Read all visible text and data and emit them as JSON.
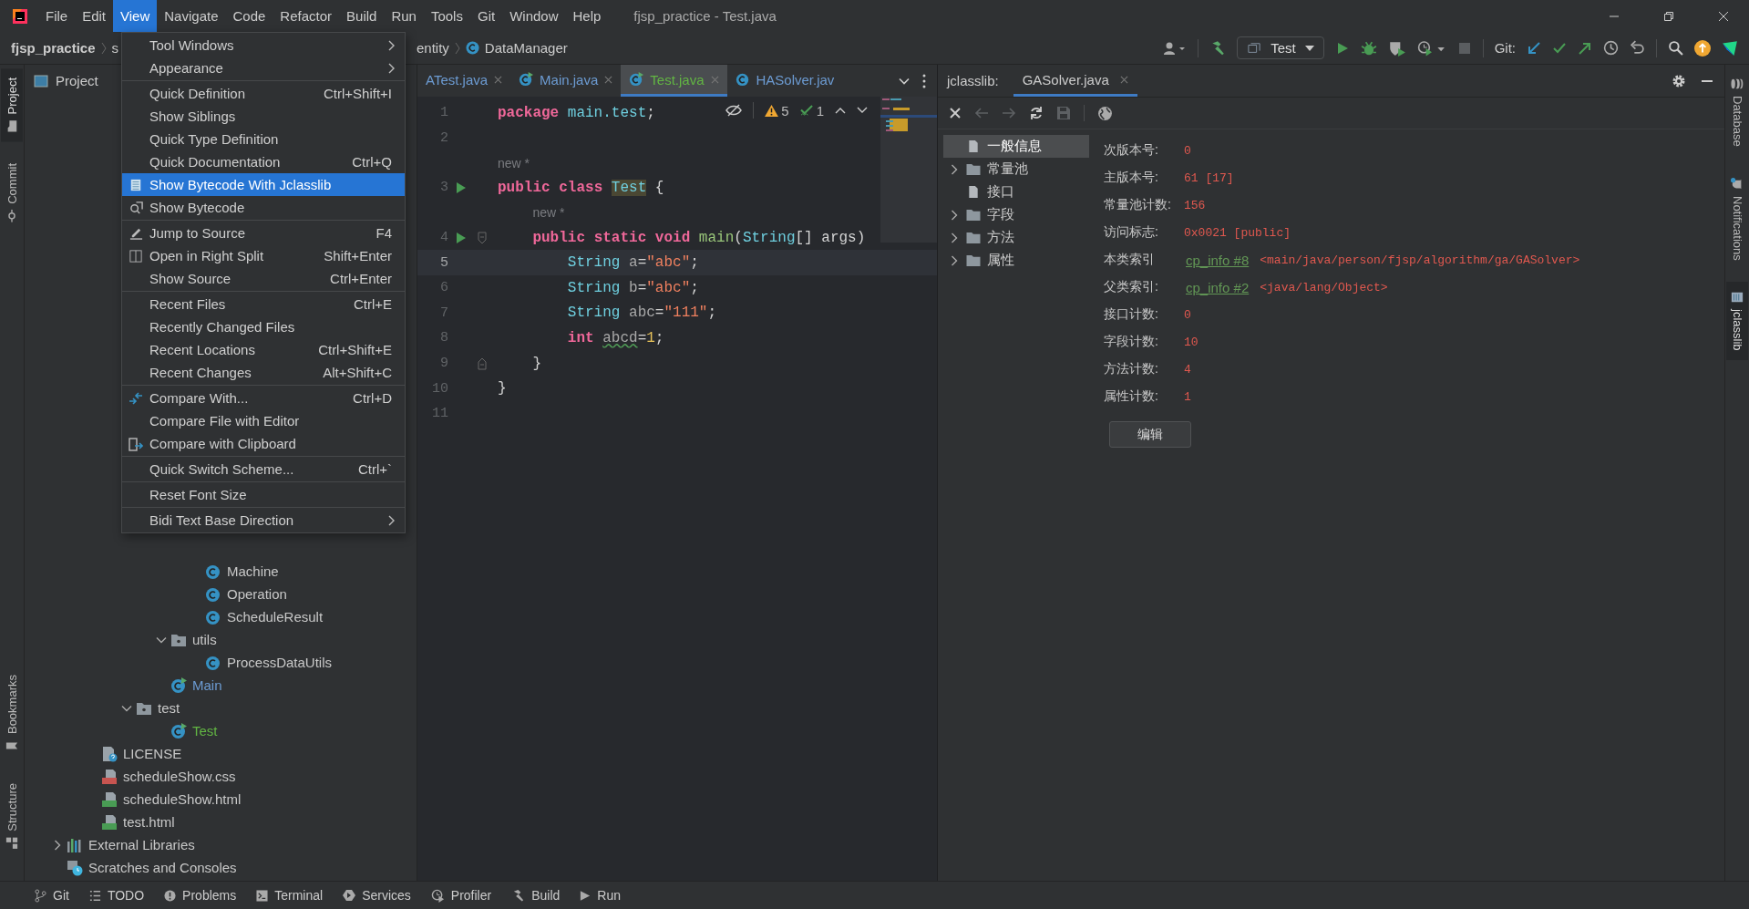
{
  "title_bar": {
    "menu": [
      {
        "label": "File",
        "selected": false
      },
      {
        "label": "Edit",
        "selected": false
      },
      {
        "label": "View",
        "selected": true
      },
      {
        "label": "Navigate",
        "selected": false
      },
      {
        "label": "Code",
        "selected": false
      },
      {
        "label": "Refactor",
        "selected": false
      },
      {
        "label": "Build",
        "selected": false
      },
      {
        "label": "Run",
        "selected": false
      },
      {
        "label": "Tools",
        "selected": false
      },
      {
        "label": "Git",
        "selected": false
      },
      {
        "label": "Window",
        "selected": false
      },
      {
        "label": "Help",
        "selected": false
      }
    ],
    "title": "fjsp_practice - Test.java"
  },
  "breadcrumb": {
    "left": [
      "fjsp_practice",
      "s"
    ],
    "right": [
      "entity",
      "DataManager"
    ]
  },
  "toolbar": {
    "run_config": "Test",
    "git_label": "Git:"
  },
  "left_strip": {
    "top": [
      {
        "label": "Project",
        "selected": true
      },
      {
        "label": "Commit",
        "selected": false
      }
    ],
    "bottom": [
      {
        "label": "Bookmarks",
        "selected": false
      },
      {
        "label": "Structure",
        "selected": false
      }
    ]
  },
  "project": {
    "title": "Project",
    "tree": [
      {
        "children": [
          {
            "children": [
              {
                "children": [
                  {
                    "children": [
                      {
                        "label": "Machine",
                        "kind": "class"
                      },
                      {
                        "label": "Operation",
                        "kind": "class"
                      },
                      {
                        "label": "ScheduleResult",
                        "kind": "class"
                      }
                    ]
                  },
                  {
                    "label": "utils",
                    "kind": "package",
                    "expanded": true,
                    "children": [
                      {
                        "label": "ProcessDataUtils",
                        "kind": "class"
                      }
                    ]
                  },
                  {
                    "label": "Main",
                    "kind": "runnable-class",
                    "color": "#6c9bd2"
                  }
                ]
              },
              {
                "label": "test",
                "kind": "package",
                "expanded": true,
                "children": [
                  {
                    "label": "Test",
                    "kind": "runnable-class",
                    "color": "#62b543"
                  }
                ]
              }
            ]
          },
          {
            "label": "LICENSE",
            "kind": "license"
          },
          {
            "label": "scheduleShow.css",
            "kind": "css"
          },
          {
            "label": "scheduleShow.html",
            "kind": "html"
          },
          {
            "label": "test.html",
            "kind": "html"
          }
        ]
      },
      {
        "label": "External Libraries",
        "kind": "libraries",
        "expanded": false
      },
      {
        "label": "Scratches and Consoles",
        "kind": "scratches"
      }
    ]
  },
  "menu": {
    "groups": [
      [
        {
          "label": "Tool Windows",
          "kind": "submenu",
          "selected": false
        },
        {
          "label": "Appearance",
          "kind": "submenu",
          "selected": false
        }
      ],
      [
        {
          "label": "Quick Definition",
          "shortcut": "Ctrl+Shift+I",
          "kind": "action",
          "selected": false
        },
        {
          "label": "Show Siblings",
          "kind": "action",
          "selected": false
        },
        {
          "label": "Quick Type Definition",
          "kind": "action",
          "selected": false
        },
        {
          "label": "Quick Documentation",
          "shortcut": "Ctrl+Q",
          "kind": "action",
          "selected": false
        },
        {
          "label": "Show Bytecode With Jclasslib",
          "kind": "action",
          "selected": true
        },
        {
          "label": "Show Bytecode",
          "kind": "action",
          "selected": false
        }
      ],
      [
        {
          "label": "Jump to Source",
          "shortcut": "F4",
          "kind": "action",
          "selected": false
        },
        {
          "label": "Open in Right Split",
          "shortcut": "Shift+Enter",
          "kind": "action",
          "selected": false
        },
        {
          "label": "Show Source",
          "shortcut": "Ctrl+Enter",
          "kind": "action",
          "selected": false
        }
      ],
      [
        {
          "label": "Recent Files",
          "shortcut": "Ctrl+E",
          "kind": "action",
          "selected": false
        },
        {
          "label": "Recently Changed Files",
          "kind": "action",
          "selected": false
        },
        {
          "label": "Recent Locations",
          "shortcut": "Ctrl+Shift+E",
          "kind": "action",
          "selected": false
        },
        {
          "label": "Recent Changes",
          "shortcut": "Alt+Shift+C",
          "kind": "action",
          "selected": false
        }
      ],
      [
        {
          "label": "Compare With...",
          "shortcut": "Ctrl+D",
          "kind": "action",
          "selected": false
        },
        {
          "label": "Compare File with Editor",
          "kind": "action",
          "selected": false
        },
        {
          "label": "Compare with Clipboard",
          "kind": "action",
          "selected": false
        }
      ],
      [
        {
          "label": "Quick Switch Scheme...",
          "shortcut": "Ctrl+`",
          "kind": "action",
          "selected": false
        }
      ],
      [
        {
          "label": "Reset Font Size",
          "kind": "action",
          "selected": false
        }
      ],
      [
        {
          "label": "Bidi Text Base Direction",
          "kind": "submenu",
          "selected": false
        }
      ]
    ]
  },
  "editor": {
    "tabs": [
      {
        "label": "ATest.java",
        "kind": "none",
        "color": "#6c9bd2",
        "selected": false,
        "closable": true
      },
      {
        "label": "Main.java",
        "kind": "runnable-class",
        "color": "#6c9bd2",
        "selected": false,
        "closable": true
      },
      {
        "label": "Test.java",
        "kind": "runnable-class",
        "color": "#62b543",
        "selected": true,
        "closable": true
      },
      {
        "label": "HASolver.jav",
        "kind": "class",
        "color": "#6c9bd2",
        "selected": false
      }
    ],
    "inspections": {
      "warnings": "5",
      "weak_warnings": "1"
    },
    "lines": [
      {
        "number": "1",
        "current": false,
        "run": false,
        "tokens": [
          {
            "text": "package ",
            "kind": "keyword"
          },
          {
            "text": "main.test",
            "kind": "type"
          },
          {
            "text": ";",
            "kind": "plain"
          }
        ]
      },
      {
        "number": "2",
        "current": false,
        "run": false
      },
      {
        "number": "3",
        "current": false,
        "run": true,
        "hint": "new *",
        "tokens": [
          {
            "text": "public ",
            "kind": "keyword"
          },
          {
            "text": "class ",
            "kind": "keyword"
          },
          {
            "text": "Test",
            "kind": "decl"
          },
          {
            "text": " {",
            "kind": "plain"
          }
        ]
      },
      {
        "number": "4",
        "current": false,
        "run": true,
        "fold_start": true,
        "hint": "new *",
        "tokens": [
          {
            "text": "    public ",
            "kind": "keyword"
          },
          {
            "text": "static ",
            "kind": "keyword"
          },
          {
            "text": "void ",
            "kind": "keyword"
          },
          {
            "text": "main",
            "kind": "method"
          },
          {
            "text": "(",
            "kind": "plain"
          },
          {
            "text": "String",
            "kind": "type"
          },
          {
            "text": "[] args)",
            "kind": "plain"
          }
        ]
      },
      {
        "number": "5",
        "current": true,
        "run": false,
        "tokens": [
          {
            "text": "        String ",
            "kind": "type"
          },
          {
            "text": "a",
            "kind": "variable"
          },
          {
            "text": "=",
            "kind": "plain"
          },
          {
            "text": "\"abc\"",
            "kind": "string"
          },
          {
            "text": ";",
            "kind": "plain"
          }
        ]
      },
      {
        "number": "6",
        "current": false,
        "run": false,
        "tokens": [
          {
            "text": "        String ",
            "kind": "type"
          },
          {
            "text": "b",
            "kind": "variable"
          },
          {
            "text": "=",
            "kind": "plain"
          },
          {
            "text": "\"abc\"",
            "kind": "string"
          },
          {
            "text": ";",
            "kind": "plain"
          }
        ]
      },
      {
        "number": "7",
        "current": false,
        "run": false,
        "tokens": [
          {
            "text": "        String ",
            "kind": "type"
          },
          {
            "text": "abc",
            "kind": "variable"
          },
          {
            "text": "=",
            "kind": "plain"
          },
          {
            "text": "\"111\"",
            "kind": "string"
          },
          {
            "text": ";",
            "kind": "plain"
          }
        ]
      },
      {
        "number": "8",
        "current": false,
        "run": false,
        "tokens": [
          {
            "text": "        int ",
            "kind": "keyword"
          },
          {
            "text": "abcd",
            "kind": "unused"
          },
          {
            "text": "=",
            "kind": "plain"
          },
          {
            "text": "1",
            "kind": "number"
          },
          {
            "text": ";",
            "kind": "plain"
          }
        ]
      },
      {
        "number": "9",
        "current": false,
        "run": false,
        "fold_end": true,
        "tokens": [
          {
            "text": "    }",
            "kind": "plain"
          }
        ]
      },
      {
        "number": "10",
        "current": false,
        "run": false,
        "tokens": [
          {
            "text": "}",
            "kind": "plain"
          }
        ]
      },
      {
        "number": "11",
        "current": false,
        "run": false
      }
    ]
  },
  "jclasslib": {
    "label": "jclasslib:",
    "tabs": [
      {
        "label": "GASolver.java",
        "selected": true
      }
    ],
    "tree": [
      {
        "label": "一般信息",
        "kind": "leaf",
        "selected": true
      },
      {
        "label": "常量池",
        "kind": "folder",
        "expanded": false,
        "selected": false
      },
      {
        "label": "接口",
        "kind": "leaf",
        "selected": false
      },
      {
        "label": "字段",
        "kind": "folder",
        "expanded": false,
        "selected": false
      },
      {
        "label": "方法",
        "kind": "folder",
        "expanded": false,
        "selected": false
      },
      {
        "label": "属性",
        "kind": "folder",
        "expanded": false,
        "selected": false
      }
    ],
    "fields": [
      {
        "label": "次版本号:",
        "value": "0"
      },
      {
        "label": "主版本号:",
        "value": "61 [17]"
      },
      {
        "label": "常量池计数:",
        "value": "156"
      },
      {
        "label": "访问标志:",
        "value": "0x0021 [public]"
      },
      {
        "label": "本类索引",
        "link": "cp_info #8",
        "value": "<main/java/person/fjsp/algorithm/ga/GASolver>"
      },
      {
        "label": "父类索引:",
        "link": "cp_info #2",
        "value": "<java/lang/Object>"
      },
      {
        "label": "接口计数:",
        "value": "0"
      },
      {
        "label": "字段计数:",
        "value": "10"
      },
      {
        "label": "方法计数:",
        "value": "4"
      },
      {
        "label": "属性计数:",
        "value": "1"
      }
    ],
    "button": "编辑"
  },
  "right_strip": [
    {
      "label": "Database",
      "selected": false
    },
    {
      "label": "Notifications",
      "selected": false
    },
    {
      "label": "jclasslib",
      "selected": true
    }
  ],
  "status_bar": [
    "Git",
    "TODO",
    "Problems",
    "Terminal",
    "Services",
    "Profiler",
    "Build",
    "Run"
  ]
}
